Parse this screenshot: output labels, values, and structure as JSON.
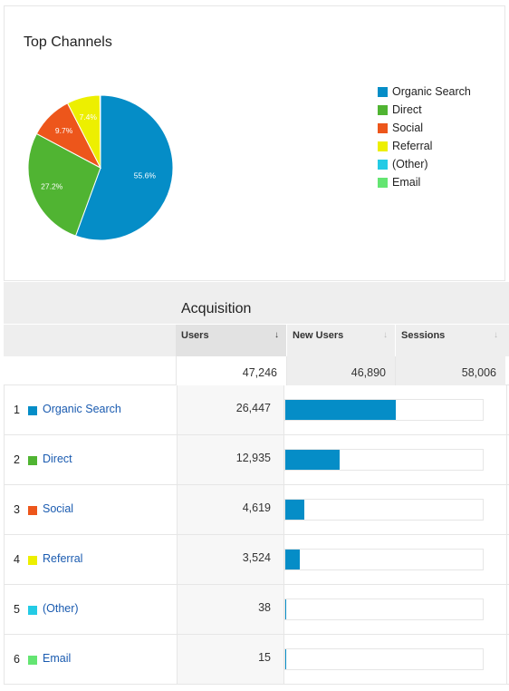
{
  "card": {
    "title": "Top Channels"
  },
  "chart_data": {
    "type": "pie",
    "title": "Top Channels",
    "slices": [
      {
        "label": "Organic Search",
        "percent": 55.6,
        "label_text": "55.6%",
        "color": "#058dc7"
      },
      {
        "label": "Direct",
        "percent": 27.2,
        "label_text": "27.2%",
        "color": "#50b432"
      },
      {
        "label": "Social",
        "percent": 9.7,
        "label_text": "9.7%",
        "color": "#ed561b"
      },
      {
        "label": "Referral",
        "percent": 7.4,
        "label_text": "7.4%",
        "color": "#edef00"
      },
      {
        "label": "(Other)",
        "percent": 0.1,
        "label_text": "",
        "color": "#24cbe5"
      },
      {
        "label": "Email",
        "percent": 0.03,
        "label_text": "",
        "color": "#64e572"
      }
    ],
    "legend_position": "right"
  },
  "legend": [
    {
      "label": "Organic Search",
      "color": "#058dc7"
    },
    {
      "label": "Direct",
      "color": "#50b432"
    },
    {
      "label": "Social",
      "color": "#ed561b"
    },
    {
      "label": "Referral",
      "color": "#edef00"
    },
    {
      "label": "(Other)",
      "color": "#24cbe5"
    },
    {
      "label": "Email",
      "color": "#64e572"
    }
  ],
  "table": {
    "group_header": "Acquisition",
    "columns": [
      {
        "label": "Users",
        "sort_icon": "↓",
        "sorted": true
      },
      {
        "label": "New Users",
        "sort_icon": "↓",
        "sorted": false
      },
      {
        "label": "Sessions",
        "sort_icon": "↓",
        "sorted": false
      }
    ],
    "totals": {
      "users": "47,246",
      "new_users": "46,890",
      "sessions": "58,006"
    },
    "rows": [
      {
        "rank": "1",
        "channel": "Organic Search",
        "color": "#058dc7",
        "users": "26,447",
        "users_num": 26447
      },
      {
        "rank": "2",
        "channel": "Direct",
        "color": "#50b432",
        "users": "12,935",
        "users_num": 12935
      },
      {
        "rank": "3",
        "channel": "Social",
        "color": "#ed561b",
        "users": "4,619",
        "users_num": 4619
      },
      {
        "rank": "4",
        "channel": "Referral",
        "color": "#edef00",
        "users": "3,524",
        "users_num": 3524
      },
      {
        "rank": "5",
        "channel": "(Other)",
        "color": "#24cbe5",
        "users": "38",
        "users_num": 38
      },
      {
        "rank": "6",
        "channel": "Email",
        "color": "#64e572",
        "users": "15",
        "users_num": 15
      }
    ],
    "bar_color": "#058dc7"
  }
}
